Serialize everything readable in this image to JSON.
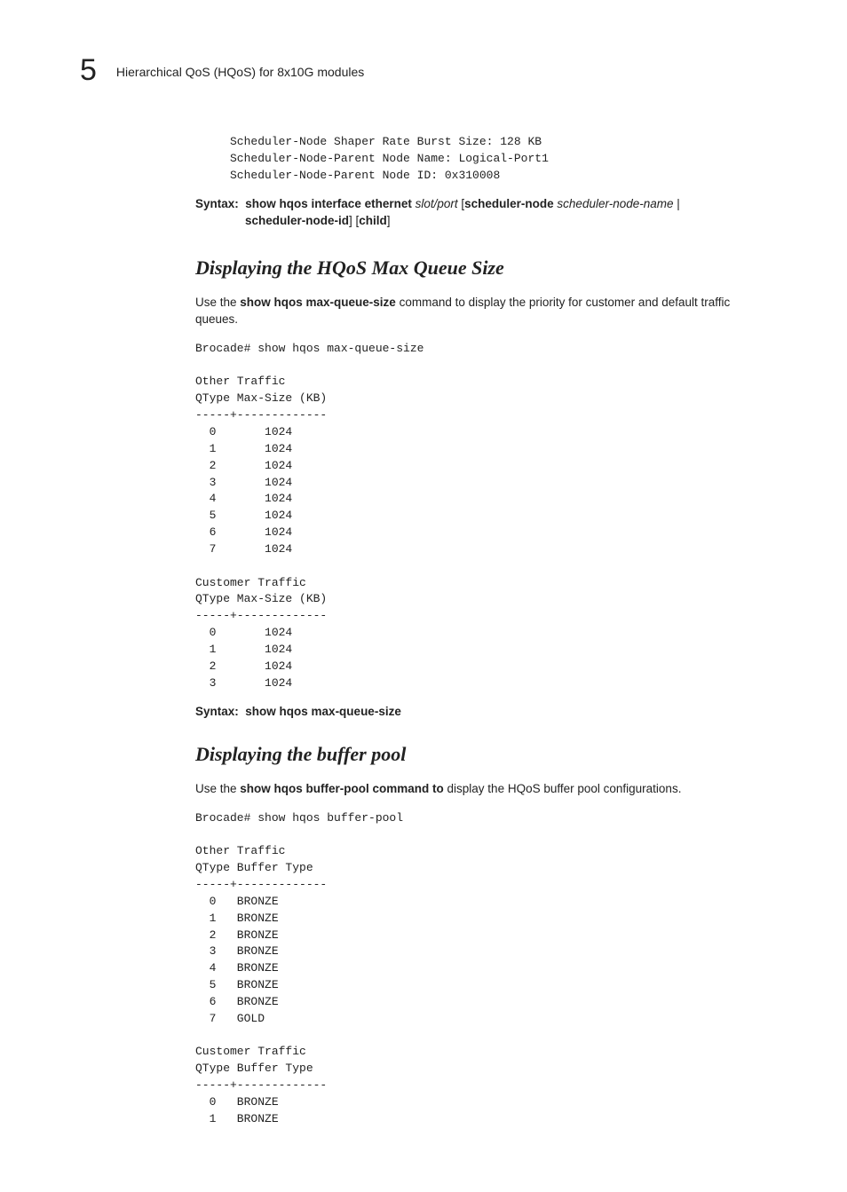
{
  "header": {
    "chapter_number": "5",
    "section": "Hierarchical QoS (HQoS) for 8x10G modules"
  },
  "leadin_code": "     Scheduler-Node Shaper Rate Burst Size: 128 KB\n     Scheduler-Node-Parent Node Name: Logical-Port1\n     Scheduler-Node-Parent Node ID: 0x310008",
  "syntax_top": {
    "label": "Syntax:",
    "p1_bold": "show hqos interface ethernet ",
    "p1_ital": "slot/port ",
    "p2_plain_open": "[",
    "p2_bold": "scheduler-node ",
    "p2_ital": "scheduler-node-name",
    "p2_plain_pipe": " | ",
    "p3_bold": "scheduler-node-id",
    "p3_plain": "] [",
    "p4_bold": "child",
    "p4_plain": "]"
  },
  "sect1": {
    "heading": "Displaying the HQoS Max Queue Size",
    "intro_pre": "Use the ",
    "intro_bold": "show hqos max-queue-size",
    "intro_post": " command to display the priority for customer and default traffic queues.",
    "code": "Brocade# show hqos max-queue-size\n\nOther Traffic\nQType Max-Size (KB)\n-----+-------------\n  0       1024\n  1       1024\n  2       1024\n  3       1024\n  4       1024\n  5       1024\n  6       1024\n  7       1024\n\nCustomer Traffic\nQType Max-Size (KB)\n-----+-------------\n  0       1024\n  1       1024\n  2       1024\n  3       1024",
    "syntax_label": "Syntax:",
    "syntax_cmd": "show hqos max-queue-size"
  },
  "sect2": {
    "heading": "Displaying the buffer pool",
    "intro_pre": "Use the ",
    "intro_bold": "show hqos buffer-pool command to",
    "intro_post": " display the HQoS buffer pool configurations.",
    "code": "Brocade# show hqos buffer-pool\n\nOther Traffic\nQType Buffer Type\n-----+-------------\n  0   BRONZE\n  1   BRONZE\n  2   BRONZE\n  3   BRONZE\n  4   BRONZE\n  5   BRONZE\n  6   BRONZE\n  7   GOLD\n\nCustomer Traffic\nQType Buffer Type\n-----+-------------\n  0   BRONZE\n  1   BRONZE"
  }
}
